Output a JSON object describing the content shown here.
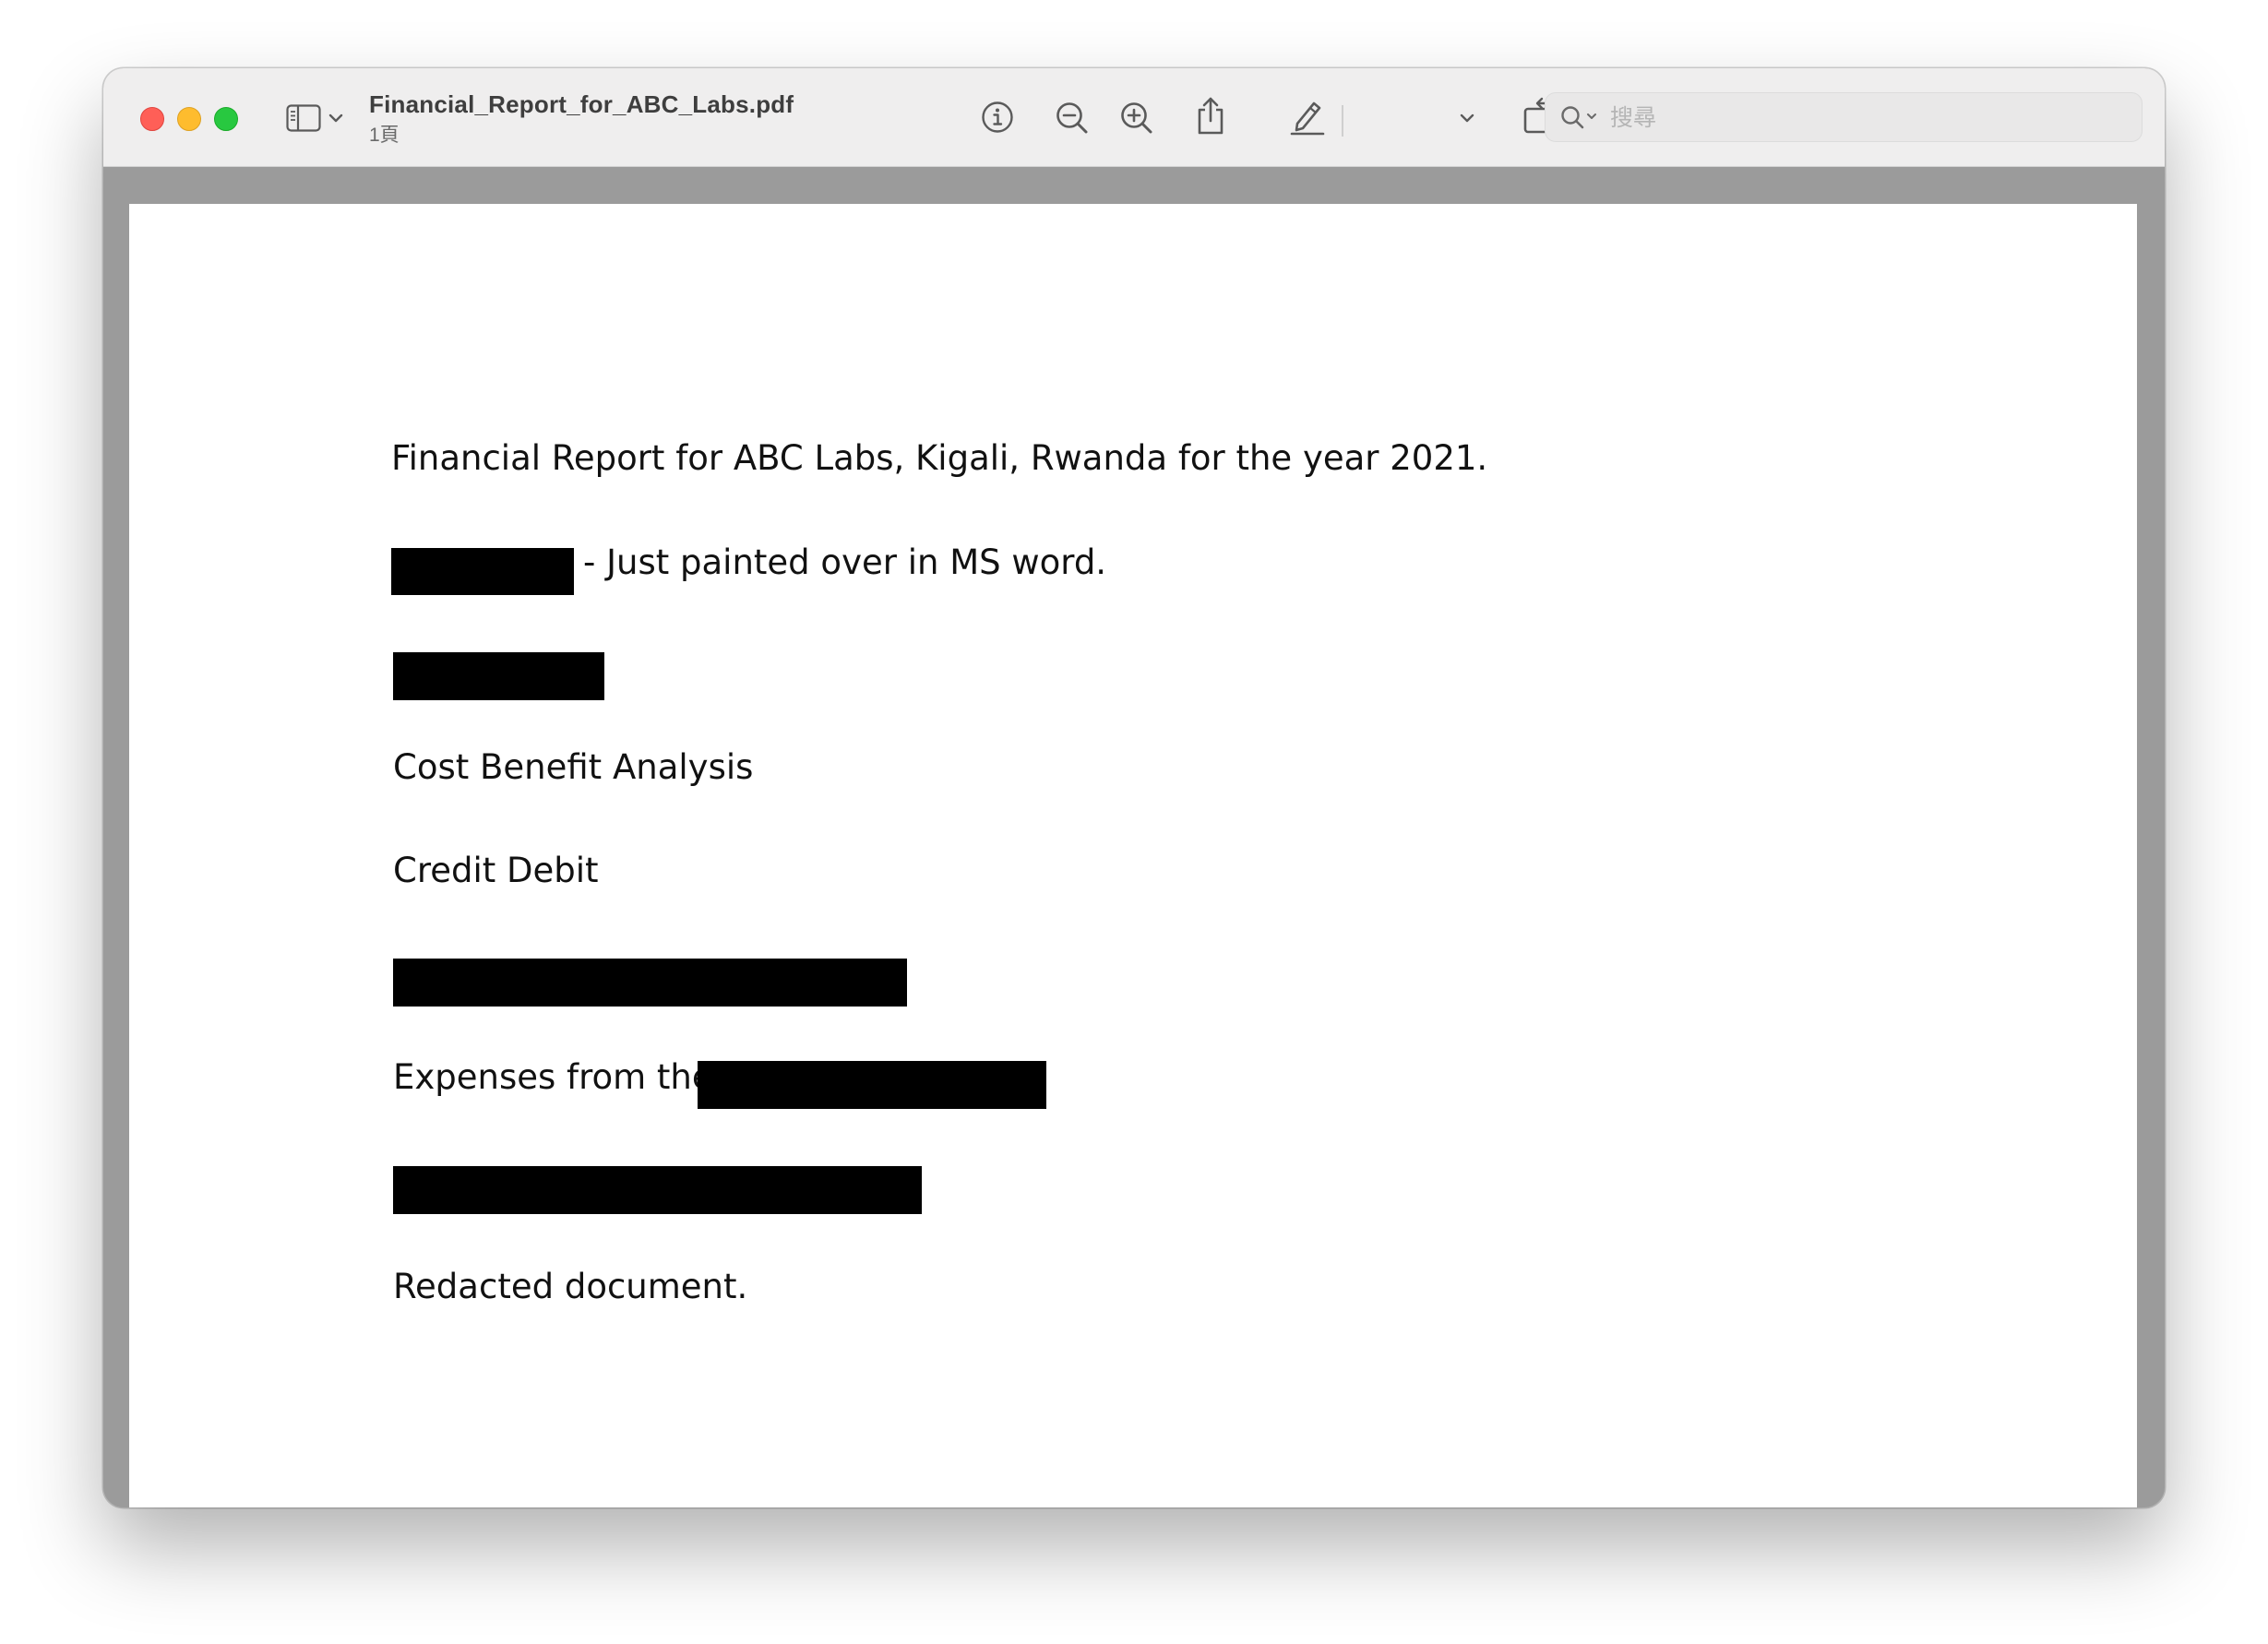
{
  "window": {
    "document_name": "Financial_Report_for_ABC_Labs.pdf",
    "page_count": "1頁"
  },
  "toolbar": {
    "icons": {
      "sidebar": "sidebar-icon",
      "sidebar_menu": "chevron-down-icon",
      "info": "info-icon",
      "zoom_out": "zoom-out-icon",
      "zoom_in": "zoom-in-icon",
      "share": "share-icon",
      "highlight": "highlighter-icon",
      "highlight_menu": "chevron-down-icon",
      "rotate": "rotate-icon",
      "markup": "markup-icon"
    },
    "search": {
      "placeholder": "搜尋",
      "value": ""
    }
  },
  "document": {
    "lines": {
      "title": "Financial Report for ABC Labs, Kigali, Rwanda for the year 2021.",
      "painted_note": "- Just painted over in MS word.",
      "cost_benefit": "Cost Benefit Analysis",
      "credit_debit": "Credit Debit",
      "expenses": "Expenses from the",
      "closing": "Redacted document."
    }
  },
  "colors": {
    "close": "#ff5f57",
    "minimize": "#febc2e",
    "zoom": "#28c840",
    "redaction": "#000000",
    "viewer_background": "#9b9b9b"
  }
}
